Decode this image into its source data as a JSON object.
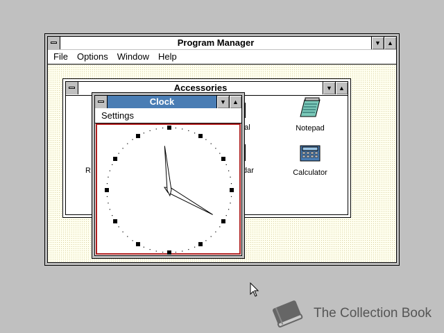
{
  "program_manager": {
    "title": "Program Manager",
    "menu": [
      "File",
      "Options",
      "Window",
      "Help"
    ]
  },
  "accessories": {
    "title": "Accessories",
    "icons": [
      {
        "label": "Notepad",
        "icon": "notepad-icon"
      },
      {
        "label": "Calculator",
        "icon": "calculator-icon"
      }
    ],
    "partial_labels": [
      "nal",
      "dar",
      "R"
    ]
  },
  "clock": {
    "title": "Clock",
    "menu_settings": "Settings",
    "time_shown": "3:59"
  },
  "watermark": {
    "text": "The Collection Book"
  },
  "colors": {
    "active_title": "#4a7db4",
    "clock_border": "#b02020",
    "desktop": "#c0c0c0",
    "client_bg": "#fffff0"
  }
}
